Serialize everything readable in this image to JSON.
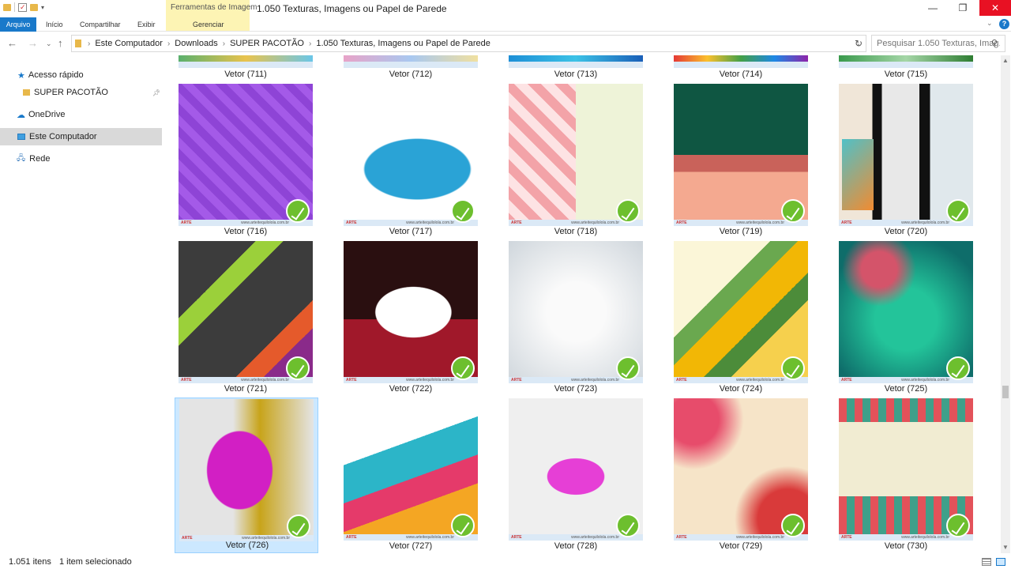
{
  "window": {
    "title": "1.050 Texturas, Imagens ou Papel de Parede",
    "context_tab_title": "Ferramentas de Imagem",
    "controls": {
      "minimize": "—",
      "maximize": "❐",
      "close": "✕"
    }
  },
  "ribbon": {
    "tabs": [
      {
        "label": "Arquivo"
      },
      {
        "label": "Início"
      },
      {
        "label": "Compartilhar"
      },
      {
        "label": "Exibir"
      },
      {
        "label": "Gerenciar"
      }
    ],
    "help": "?"
  },
  "address_bar": {
    "breadcrumbs": [
      "Este Computador",
      "Downloads",
      "SUPER PACOTÃO",
      "1.050 Texturas, Imagens ou Papel de Parede"
    ],
    "search_placeholder": "Pesquisar 1.050 Texturas, Imag..."
  },
  "sidebar": {
    "items": [
      {
        "label": "Acesso rápido",
        "icon": "star-icon"
      },
      {
        "label": "SUPER PACOTÃO",
        "icon": "folder-icon",
        "pinned": true
      },
      {
        "label": "OneDrive",
        "icon": "cloud-icon"
      },
      {
        "label": "Este Computador",
        "icon": "computer-icon",
        "selected": true
      },
      {
        "label": "Rede",
        "icon": "network-icon"
      }
    ]
  },
  "files": [
    {
      "name": "Vetor (711)"
    },
    {
      "name": "Vetor (712)"
    },
    {
      "name": "Vetor (713)"
    },
    {
      "name": "Vetor (714)"
    },
    {
      "name": "Vetor (715)"
    },
    {
      "name": "Vetor (716)"
    },
    {
      "name": "Vetor (717)"
    },
    {
      "name": "Vetor (718)"
    },
    {
      "name": "Vetor (719)"
    },
    {
      "name": "Vetor (720)"
    },
    {
      "name": "Vetor (721)"
    },
    {
      "name": "Vetor (722)"
    },
    {
      "name": "Vetor (723)"
    },
    {
      "name": "Vetor (724)"
    },
    {
      "name": "Vetor (725)"
    },
    {
      "name": "Vetor (726)",
      "selected": true
    },
    {
      "name": "Vetor (727)"
    },
    {
      "name": "Vetor (728)"
    },
    {
      "name": "Vetor (729)"
    },
    {
      "name": "Vetor (730)"
    }
  ],
  "thumb_text": {
    "brand": "ARTE",
    "url": "www.arteitequilolola.com.br"
  },
  "statusbar": {
    "item_count": "1.051 itens",
    "selection": "1 item selecionado"
  },
  "colors": {
    "accent": "#1979ca",
    "context_band": "#fdf4b4",
    "close_button": "#e81123",
    "selection": "#cce8ff"
  }
}
